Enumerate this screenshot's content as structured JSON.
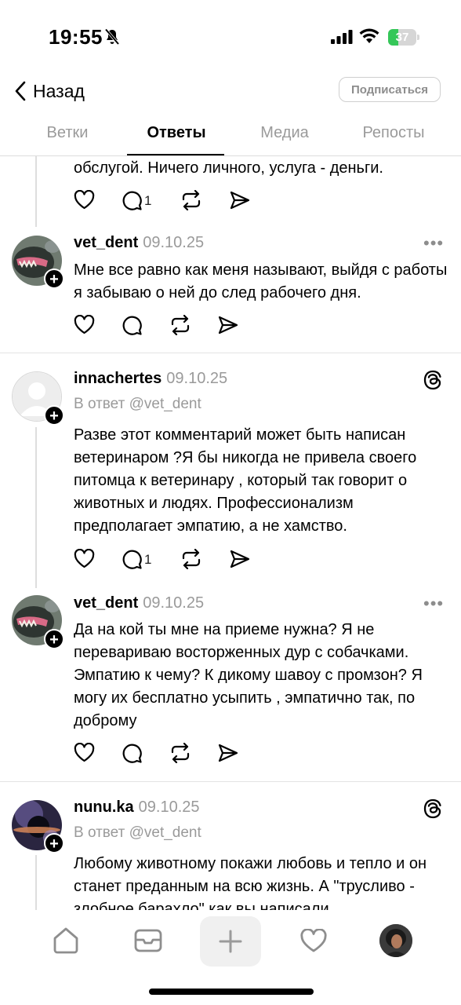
{
  "status_bar": {
    "time": "19:55",
    "battery": "37",
    "battery_level": 0.37
  },
  "header": {
    "back_label": "Назад",
    "subscribe_label": "Подписаться"
  },
  "tabs": [
    {
      "label": "Ветки"
    },
    {
      "label": "Ответы"
    },
    {
      "label": "Медиа"
    },
    {
      "label": "Репосты"
    }
  ],
  "posts": [
    {
      "text": "обслугой. Ничего личного, услуга - деньги.",
      "reply_count": "1"
    },
    {
      "username": "vet_dent",
      "date": "09.10.25",
      "text": "Мне все равно как меня называют, выйдя с работы я забываю о ней до след рабочего дня."
    },
    {
      "username": "innachertes",
      "date": "09.10.25",
      "reply_to": "В ответ @vet_dent",
      "text": "Разве этот комментарий может быть написан ветеринаром ?Я бы никогда не привела своего питомца к ветеринару , который так говорит о животных и людях. Профессионализм предполагает эмпатию, а не хамство.",
      "reply_count": "1"
    },
    {
      "username": "vet_dent",
      "date": "09.10.25",
      "text": "Да на кой ты мне на приеме нужна? Я не перевариваю восторженных дур с собачками. Эмпатию к чему? К дикому шавоу с промзон? Я могу их бесплатно усыпить , эмпатично так, по доброму"
    },
    {
      "username": "nunu.ka",
      "date": "09.10.25",
      "reply_to": "В ответ @vet_dent",
      "text": "Любому животному покажи любовь и тепло и он станет преданным на всю жизнь. А \"трусливо - злобное барахло\" как вы написали"
    }
  ],
  "icons": {
    "home": "home-icon",
    "inbox": "inbox-icon",
    "compose": "plus-icon",
    "activity": "heart-icon",
    "profile": "avatar",
    "like": "heart-icon",
    "reply": "comment-icon",
    "repost": "repost-icon",
    "share": "send-icon"
  },
  "colors": {
    "accent": "#000000",
    "muted": "#9a9a9a",
    "battery": "#35c759"
  }
}
